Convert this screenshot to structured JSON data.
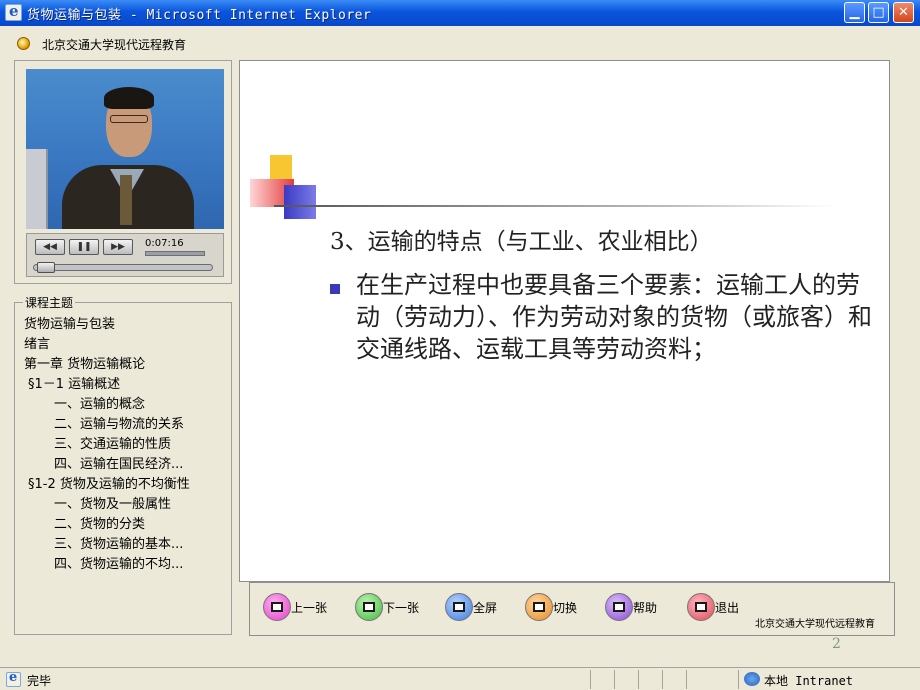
{
  "window": {
    "title": "货物运输与包装 - Microsoft Internet Explorer",
    "minimize": "▁",
    "maximize": "□",
    "close": "✕"
  },
  "header": {
    "org": "北京交通大学现代远程教育"
  },
  "player": {
    "rewind": "◀◀",
    "pause": "❚❚",
    "forward": "▶▶",
    "time": "0:07:16",
    "progress": 0.05
  },
  "outline": {
    "legend": "课程主题",
    "items": [
      {
        "text": "货物运输与包装",
        "level": 0
      },
      {
        "text": "绪言",
        "level": 0
      },
      {
        "text": "第一章 货物运输概论",
        "level": 0
      },
      {
        "text": "§1－1 运输概述",
        "level": 1
      },
      {
        "text": "一、运输的概念",
        "level": 2
      },
      {
        "text": "二、运输与物流的关系",
        "level": 2
      },
      {
        "text": "三、交通运输的性质",
        "level": 2
      },
      {
        "text": "四、运输在国民经济...",
        "level": 2
      },
      {
        "text": "§1-2 货物及运输的不均衡性",
        "level": 1
      },
      {
        "text": "一、货物及一般属性",
        "level": 2
      },
      {
        "text": "二、货物的分类",
        "level": 2
      },
      {
        "text": "三、货物运输的基本...",
        "level": 2
      },
      {
        "text": "四、货物运输的不均...",
        "level": 2
      }
    ]
  },
  "slide": {
    "heading": "3、运输的特点（与工业、农业相比）",
    "body": "在生产过程中也要具备三个要素：运输工人的劳动（劳动力）、作为劳动对象的货物（或旅客）和交通线路、运载工具等劳动资料；",
    "page_number": "2",
    "colors": {
      "yellow": "#f7c630",
      "red": "#e23d3d",
      "blue": "#3a3ac4"
    }
  },
  "nav": {
    "buttons": [
      {
        "label": "上一张",
        "icon": "previous-slide-icon",
        "color": "#e040c8"
      },
      {
        "label": "下一张",
        "icon": "next-slide-icon",
        "color": "#40b840"
      },
      {
        "label": "全屏",
        "icon": "fullscreen-icon",
        "color": "#3a7ae0"
      },
      {
        "label": "切换",
        "icon": "switch-icon",
        "color": "#e88a20"
      },
      {
        "label": "帮助",
        "icon": "help-icon",
        "color": "#8a48d0"
      },
      {
        "label": "退出",
        "icon": "exit-icon",
        "color": "#e04858"
      }
    ],
    "org": "北京交通大学现代远程教育"
  },
  "status": {
    "text": "完毕",
    "zone": "本地 Intranet"
  }
}
